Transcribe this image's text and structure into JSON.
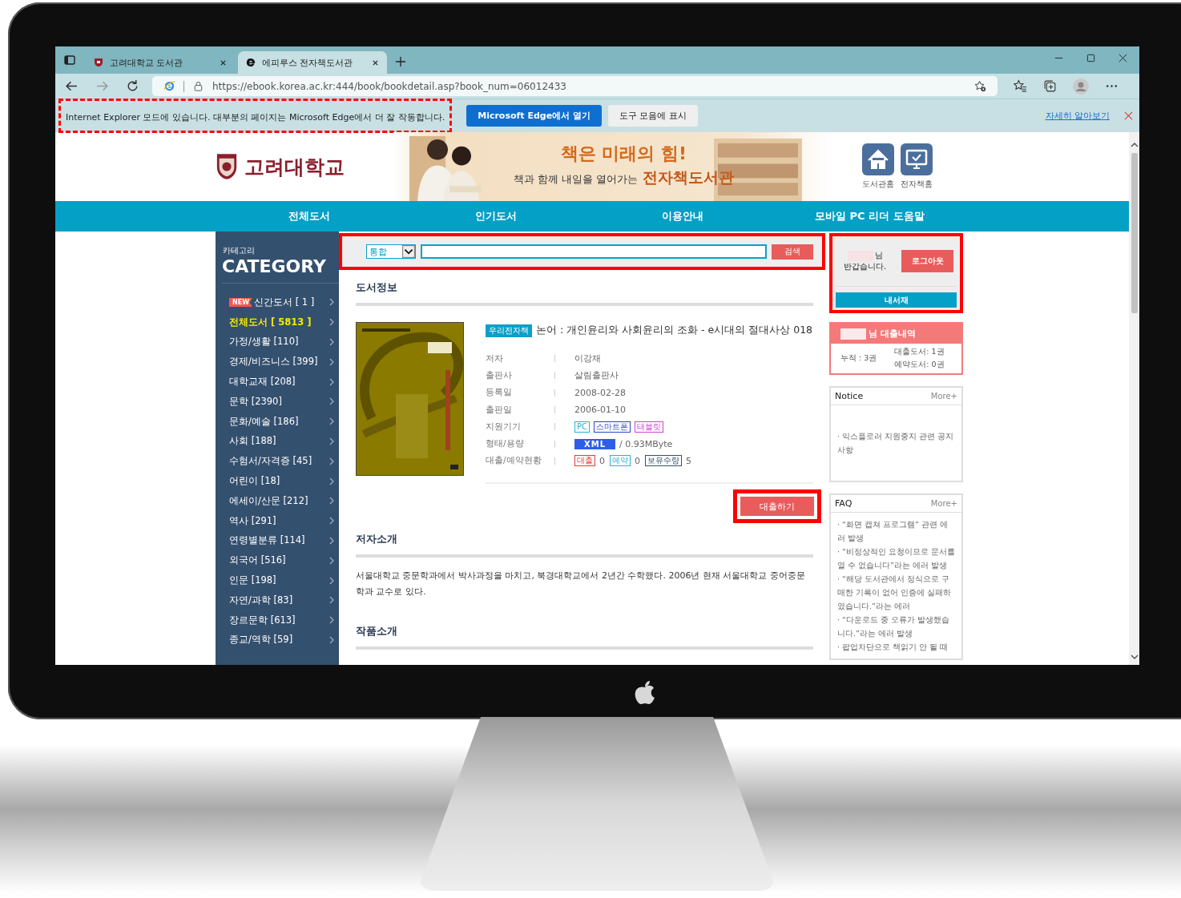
{
  "browser": {
    "tabs": [
      {
        "title": "고려대학교 도서관",
        "selected": false
      },
      {
        "title": "에피루스 전자책도서관",
        "selected": true
      }
    ],
    "url": "https://ebook.korea.ac.kr:444/book/bookdetail.asp?book_num=06012433"
  },
  "ie_banner": {
    "message": "Internet Explorer 모드에 있습니다. 대부분의 페이지는 Microsoft Edge에서 더 잘 작동합니다.",
    "open_button": "Microsoft Edge에서 열기",
    "toolbar_button": "도구 모음에 표시",
    "learn_more": "자세히 알아보기"
  },
  "site": {
    "logo": "고려대학교",
    "headline": "책은 미래의 힘!",
    "subline": "책과 함께 내일을 열어가는",
    "subline_strong": "전자책도서관",
    "quick_links": [
      {
        "kind": "home",
        "label": "도서관홈"
      },
      {
        "kind": "ebook",
        "label": "전자책홈"
      }
    ],
    "nav": [
      "전체도서",
      "인기도서",
      "이용안내",
      "모바일 PC 리더 도움말"
    ]
  },
  "sidebar": {
    "subtitle": "카테고리",
    "title": "CATEGORY",
    "items": [
      {
        "label": "신간도서 [ 1 ]",
        "badge": "NEW",
        "selected": false
      },
      {
        "label": "전체도서 [ 5813 ]",
        "selected": true
      },
      {
        "label": "가정/생활 [110]",
        "selected": false
      },
      {
        "label": "경제/비즈니스 [399]",
        "selected": false
      },
      {
        "label": "대학교재 [208]",
        "selected": false
      },
      {
        "label": "문학 [2390]",
        "selected": false
      },
      {
        "label": "문화/예술 [186]",
        "selected": false
      },
      {
        "label": "사회 [188]",
        "selected": false
      },
      {
        "label": "수험서/자격증 [45]",
        "selected": false
      },
      {
        "label": "어린이 [18]",
        "selected": false
      },
      {
        "label": "에세이/산문 [212]",
        "selected": false
      },
      {
        "label": "역사 [291]",
        "selected": false
      },
      {
        "label": "연령별분류 [114]",
        "selected": false
      },
      {
        "label": "외국어 [516]",
        "selected": false
      },
      {
        "label": "인문 [198]",
        "selected": false
      },
      {
        "label": "자연/과학 [83]",
        "selected": false
      },
      {
        "label": "장르문학 [613]",
        "selected": false
      },
      {
        "label": "종교/역학 [59]",
        "selected": false
      }
    ]
  },
  "search": {
    "scope": "통합",
    "button": "검색"
  },
  "book": {
    "section_title": "도서정보",
    "badge": "우리전자책",
    "title": "논어 : 개인윤리와 사회윤리의 조화 - e시대의 절대사상 018",
    "rows": [
      {
        "kind": "text",
        "label": "저자",
        "value": "이강재"
      },
      {
        "kind": "text",
        "label": "출판사",
        "value": "살림출판사"
      },
      {
        "kind": "text",
        "label": "등록일",
        "value": "2008-02-28"
      },
      {
        "kind": "text",
        "label": "출판일",
        "value": "2006-01-10"
      },
      {
        "kind": "tags",
        "label": "지원기기",
        "tags": [
          {
            "text": "PC",
            "color": "#2ab0d8"
          },
          {
            "text": "스마트폰",
            "color": "#2f3fcf"
          },
          {
            "text": "태블릿",
            "color": "#cc44cc"
          }
        ]
      },
      {
        "kind": "format",
        "label": "형태/용량",
        "format": "XML",
        "size": "/ 0.93MByte"
      },
      {
        "kind": "status",
        "label": "대출/예약현황",
        "counts": [
          {
            "tag": "대출",
            "count": "0",
            "color": "#e5393a"
          },
          {
            "tag": "예약",
            "count": "0",
            "color": "#2ab0d8"
          },
          {
            "tag": "보유수량",
            "count": "5",
            "color": "#34506f"
          }
        ]
      }
    ],
    "loan_button": "대출하기"
  },
  "author": {
    "heading": "저자소개",
    "text": "서울대학교 중문학과에서 박사과정을 마치고, 북경대학교에서 2년간 수학했다. 2006년 현재 서울대학교 중어중문학과 교수로 있다."
  },
  "works": {
    "heading": "작품소개"
  },
  "login": {
    "name_suffix": "님",
    "greeting": "반갑습니다.",
    "logout": "로그아웃",
    "my_library": "내서재"
  },
  "loans": {
    "title": "님 대출내역",
    "total": "누적 : 3권",
    "loaned": "대출도서: 1권",
    "reserved": "예약도서: 0권"
  },
  "notice": {
    "title": "Notice",
    "more": "More+",
    "items": [
      "· 익스플로러 지원중지 관련 공지사항"
    ]
  },
  "faq": {
    "title": "FAQ",
    "more": "More+",
    "items": [
      "· “화면 캡쳐 프로그램” 관련 에러 발생",
      "· “비정상적인 요청이므로 문서를 열 수 없습니다”라는 에러 발생",
      "· “해당 도서관에서 정식으로 구매한 기록이 없어 인증에 실패하였습니다.”라는 에러",
      "· “다운로드 중 오류가 발생했습니다.”라는 에러 발생",
      "· 팝업차단으로 책읽기 안 될 때"
    ]
  }
}
